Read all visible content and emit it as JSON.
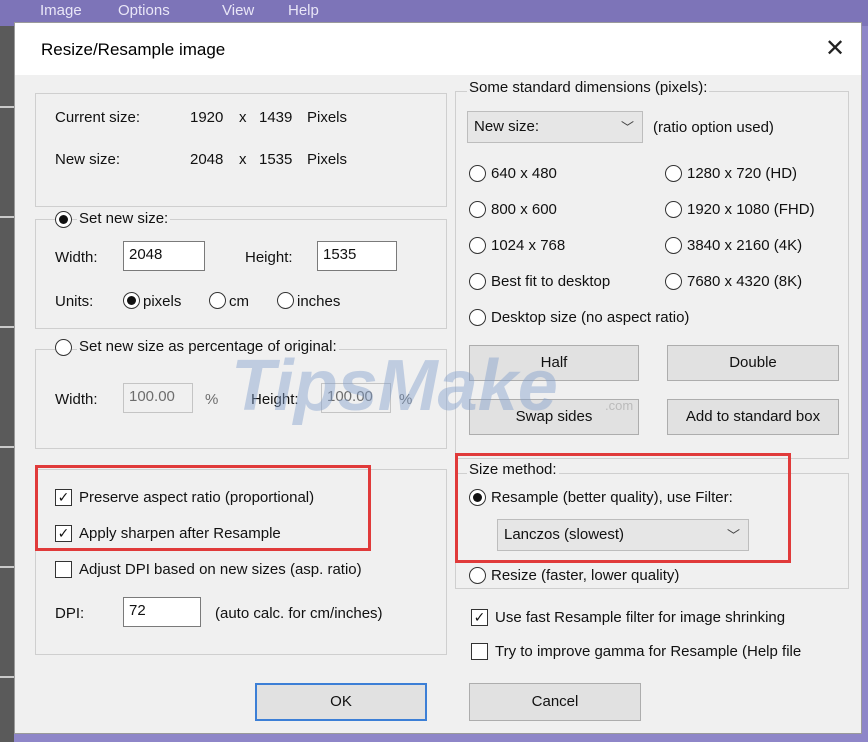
{
  "window": {
    "title": "Resize/Resample image",
    "close_glyph": "✕"
  },
  "background_menu": [
    "Image",
    "Options",
    "View",
    "Help"
  ],
  "current_size": {
    "label": "Current size:",
    "width": "1920",
    "x": "x",
    "height": "1439",
    "unit": "Pixels"
  },
  "new_size": {
    "label": "New size:",
    "width": "2048",
    "x": "x",
    "height": "1535",
    "unit": "Pixels"
  },
  "set_new_size": {
    "label": "Set new size:",
    "width_label": "Width:",
    "width_value": "2048",
    "height_label": "Height:",
    "height_value": "1535",
    "units_label": "Units:",
    "units": [
      "pixels",
      "cm",
      "inches"
    ],
    "selected_unit": "pixels"
  },
  "percentage": {
    "label": "Set new size as percentage of original:",
    "width_label": "Width:",
    "width_value": "100.00",
    "width_unit": "%",
    "height_label": "Height:",
    "height_value": "100.00",
    "height_unit": "%"
  },
  "options": {
    "preserve_aspect": "Preserve aspect ratio (proportional)",
    "apply_sharpen": "Apply sharpen after Resample",
    "adjust_dpi": "Adjust DPI based on new sizes (asp. ratio)",
    "dpi_label": "DPI:",
    "dpi_value": "72",
    "dpi_note": "(auto calc. for cm/inches)",
    "check_glyph": "✓"
  },
  "standard": {
    "title": "Some standard dimensions (pixels):",
    "dropdown": "New size:",
    "note": "(ratio option used)",
    "left": [
      "640 x 480",
      "800 x 600",
      "1024 x 768",
      "Best fit to desktop"
    ],
    "right": [
      "1280 x 720  (HD)",
      "1920 x 1080 (FHD)",
      "3840 x 2160 (4K)",
      "7680 x 4320 (8K)"
    ],
    "desktop": "Desktop size (no aspect ratio)",
    "buttons": {
      "half": "Half",
      "double": "Double",
      "swap": "Swap sides",
      "add": "Add to standard box"
    }
  },
  "size_method": {
    "title": "Size method:",
    "resample": "Resample (better quality), use Filter:",
    "filter": "Lanczos (slowest)",
    "resize": "Resize (faster, lower quality)",
    "fast_resample": "Use fast Resample filter for image shrinking",
    "gamma": "Try to improve gamma for Resample (Help file"
  },
  "footer": {
    "ok": "OK",
    "cancel": "Cancel"
  },
  "watermark": {
    "main": "TipsMake",
    "sub": ".com"
  },
  "chevron_glyph": "﹀",
  "colors": {
    "highlight": "#e03a3a",
    "default_button_border": "#3c7fd6"
  }
}
